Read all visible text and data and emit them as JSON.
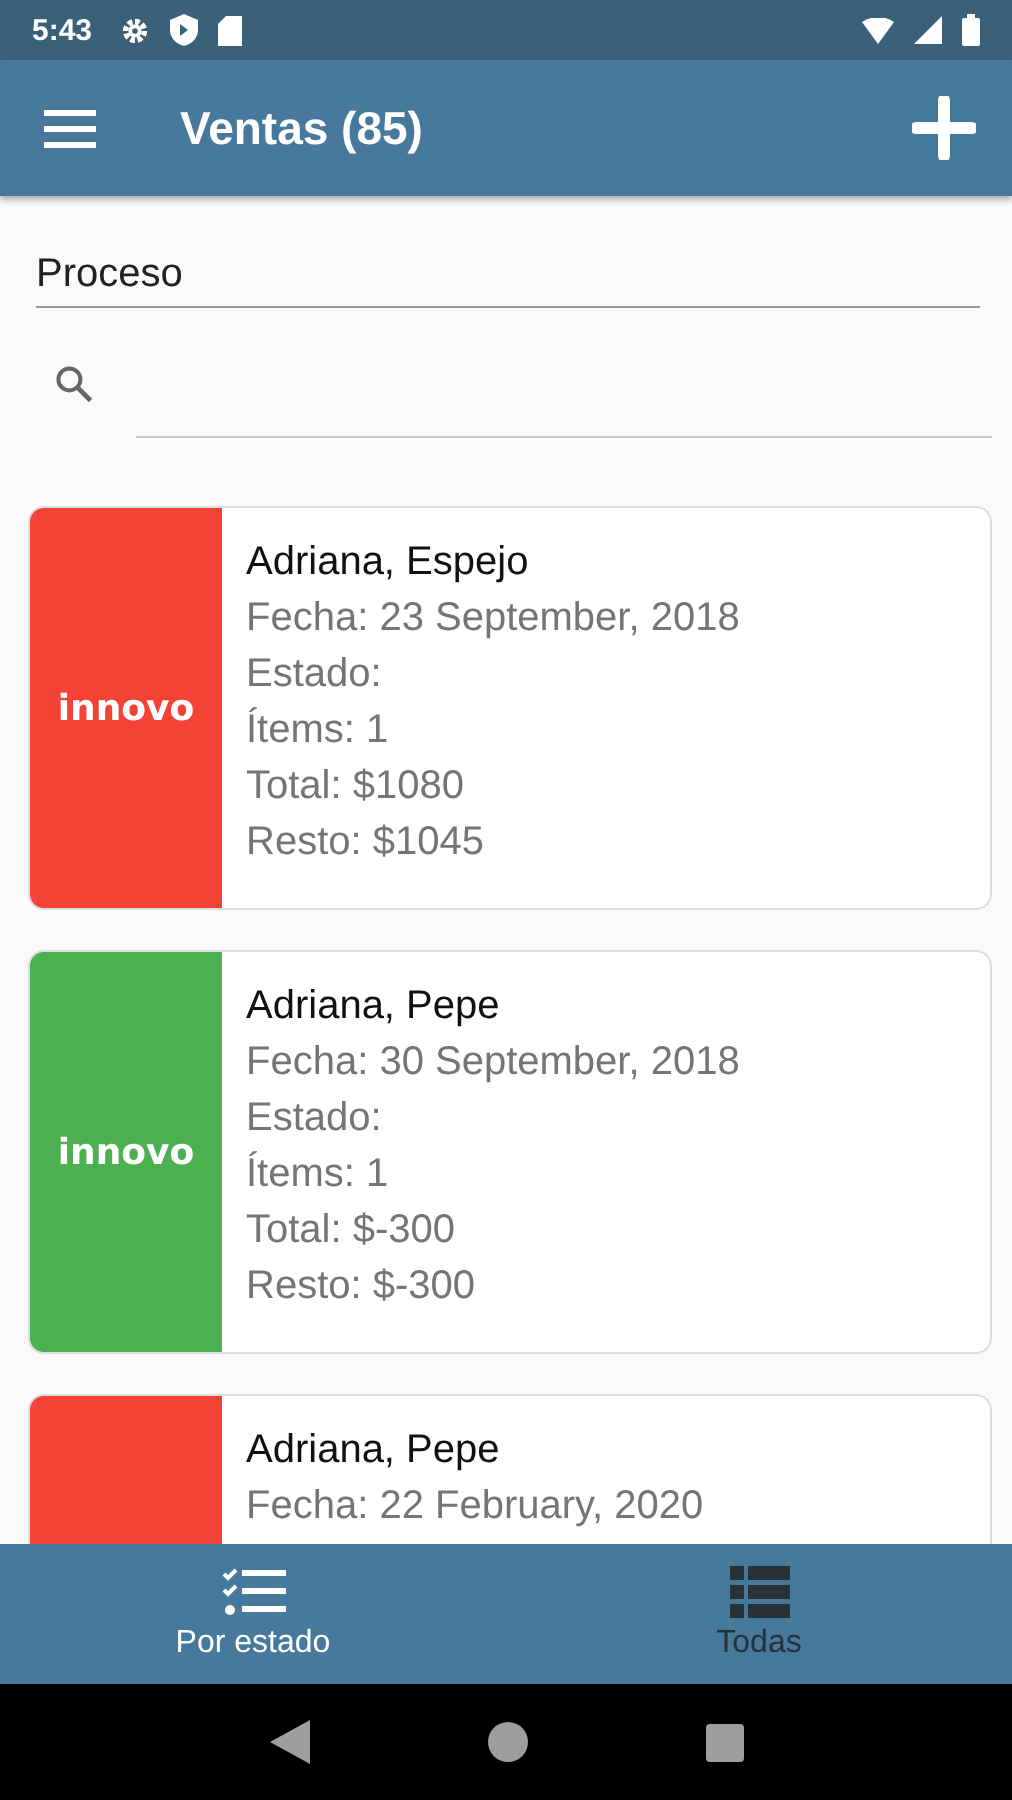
{
  "status_bar": {
    "time": "5:43"
  },
  "app_bar": {
    "title": "Ventas (85)"
  },
  "filter": {
    "value": "Proceso"
  },
  "sales": [
    {
      "color": "#f44336",
      "logo": "innovo",
      "name": "Adriana, Espejo",
      "lines": [
        "Fecha: 23 September, 2018",
        "Estado:",
        "Ítems: 1",
        "Total: $1080",
        "Resto: $1045"
      ]
    },
    {
      "color": "#4caf50",
      "logo": "innovo",
      "name": "Adriana, Pepe",
      "lines": [
        "Fecha: 30 September, 2018",
        "Estado:",
        "Ítems: 1",
        "Total: $-300",
        "Resto: $-300"
      ]
    },
    {
      "color": "#f44336",
      "name": "Adriana, Pepe",
      "lines": [
        "Fecha: 22 February, 2020"
      ]
    }
  ],
  "bottom_tabs": [
    {
      "label": "Por estado",
      "kind": "checklist",
      "selected": true
    },
    {
      "label": "Todas",
      "kind": "list",
      "selected": false
    }
  ]
}
